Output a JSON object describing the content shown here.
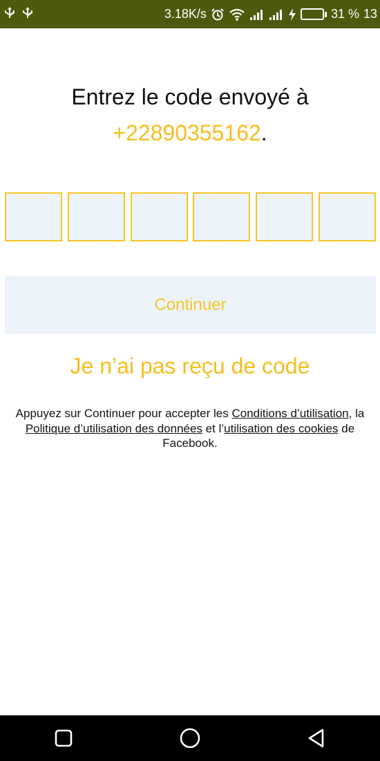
{
  "status_bar": {
    "left_icons": [
      "usb-icon",
      "usb-debug-icon"
    ],
    "net_speed": "3.18K/s",
    "battery_percent": "31 %",
    "battery_level": 0.31,
    "time": "13",
    "colors": {
      "background": "#4d5a0d",
      "battery_fill": "#35c94a"
    }
  },
  "verification": {
    "title_line1": "Entrez le code envoyé à",
    "phone_number": "+22890355162",
    "period": ".",
    "code_digits": [
      "",
      "",
      "",
      "",
      "",
      ""
    ],
    "continue_label": "Continuer",
    "resend_label": "Je n’ai pas reçu de code"
  },
  "terms": {
    "prefix": "Appuyez sur Continuer pour accepter les ",
    "terms_link": "Conditions d’utilisation",
    "comma_la": ", la ",
    "data_policy_link": "Politique d’utilisation des données",
    "and_l": " et l’",
    "cookies_link": "utilisation des cookies",
    "suffix": " de Facebook."
  },
  "nav_bar": {
    "buttons": [
      "recents-button",
      "home-button",
      "back-button"
    ]
  },
  "colors": {
    "accent": "#f5be1e",
    "input_background": "#ecf3fb",
    "text": "#111111"
  }
}
